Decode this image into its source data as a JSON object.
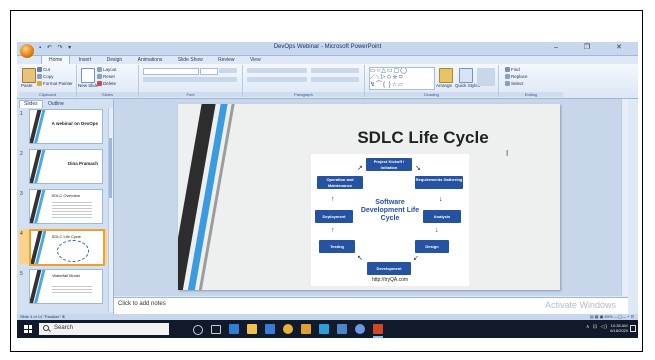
{
  "window": {
    "title": "DevOps Webinar - Microsoft PowerPoint",
    "qat": "▪ ↶ ↷ ▾",
    "controls": "– ❐ ✕"
  },
  "ribbon": {
    "tabs": [
      "Home",
      "Insert",
      "Design",
      "Animations",
      "Slide Show",
      "Review",
      "View"
    ],
    "clipboard": {
      "label": "Clipboard",
      "paste": "Paste",
      "cut": "Cut",
      "copy": "Copy",
      "format_painter": "Format Painter"
    },
    "slides": {
      "label": "Slides",
      "new_slide": "New Slide",
      "layout": "Layout",
      "reset": "Reset",
      "delete": "Delete"
    },
    "font": {
      "label": "Font"
    },
    "paragraph": {
      "label": "Paragraph"
    },
    "drawing": {
      "label": "Drawing",
      "arrange": "Arrange",
      "quick_styles": "Quick Styles"
    },
    "editing": {
      "label": "Editing",
      "find": "Find",
      "replace": "Replace",
      "select": "Select"
    }
  },
  "left_pane": {
    "tabs": [
      "Slides",
      "Outline"
    ],
    "slides": [
      {
        "num": "1",
        "title": "A webinar on DevOps",
        "kind": "title"
      },
      {
        "num": "2",
        "title": "Dina Pramach",
        "kind": "title"
      },
      {
        "num": "3",
        "title": "SDLC Overview",
        "kind": "lines"
      },
      {
        "num": "4",
        "title": "SDLC Life Cycle",
        "kind": "diagram"
      },
      {
        "num": "5",
        "title": "Waterfall Model",
        "kind": "lines"
      }
    ],
    "selected_index": 3
  },
  "slide": {
    "title": "SDLC Life Cycle",
    "center_label": "Software Development Life Cycle",
    "url": "http://tryQA.com",
    "nodes": {
      "initiation": "Project Kickoff / Initiation",
      "requirements": "Requirements Gathering",
      "analysis": "Analysis",
      "design": "Design",
      "development": "Development",
      "testing": "Testing",
      "deployment": "Deployment",
      "maintenance": "Operation and Maintenance"
    }
  },
  "notes": {
    "placeholder": "Click to add notes"
  },
  "statusbar": {
    "left": "Slide 4 of 14   \"Parallax\"   ⊗",
    "right": "▤ ▦ ▣   60%  —◯—  +  ⊡"
  },
  "watermark": "Activate Windows",
  "taskbar": {
    "search_placeholder": "Search",
    "tray": "∧  ⊡  ◁)",
    "time": "10:28 AM",
    "date": "6/18/2020"
  }
}
